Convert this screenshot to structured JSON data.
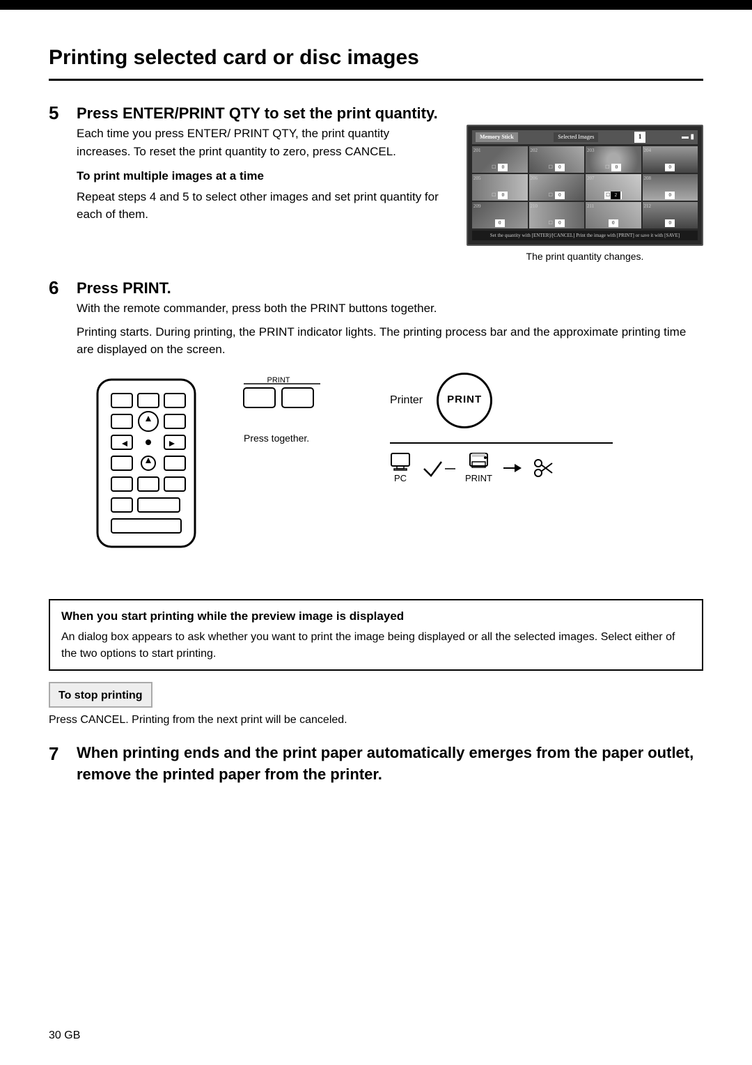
{
  "page": {
    "title": "Printing selected card or disc images",
    "footer": "30 GB"
  },
  "step5": {
    "number": "5",
    "heading": "Press ENTER/PRINT QTY to set the print quantity.",
    "body1": "Each time you press ENTER/ PRINT QTY, the print quantity increases.  To reset the print quantity to zero, press CANCEL.",
    "subheading": "To print multiple images at a time",
    "body2": "Repeat steps 4 and 5 to select other images and set print quantity for each of them.",
    "caption": "The print quantity changes."
  },
  "step6": {
    "number": "6",
    "heading": "Press PRINT.",
    "body1": "With the remote commander, press both the PRINT buttons together.",
    "body2": "Printing starts. During printing, the PRINT indicator lights.  The printing process bar and the approximate printing time are displayed on the screen.",
    "press_together": "Press together.",
    "printer_label": "Printer",
    "print_circle_label": "PRINT",
    "pc_label": "PC",
    "print_label": "PRINT"
  },
  "notice": {
    "title": "When you start printing while the preview image is displayed",
    "body": "An dialog box appears to ask whether you want to print the image being displayed or all the selected images.  Select either of the two options to start printing."
  },
  "stop_printing": {
    "label": "To stop printing",
    "body": "Press CANCEL. Printing from the next print will be canceled."
  },
  "step7": {
    "number": "7",
    "body": "When printing ends and the print paper automatically emerges from the paper outlet, remove the printed paper from the printer."
  },
  "screen": {
    "memory_stick": "Memory Stick",
    "selected_images": "Selected Images",
    "count": "1",
    "bottom_text": "Set the quantity with [ENTER]/[CANCEL] Print the image with [PRINT] or save it with [SAVE]",
    "thumbnails": [
      {
        "num": "201",
        "qty": "0",
        "class": "thumb-img-1"
      },
      {
        "num": "202",
        "qty": "0",
        "class": "thumb-img-2"
      },
      {
        "num": "203",
        "qty": "0",
        "class": "thumb-img-3"
      },
      {
        "num": "204",
        "qty": "0",
        "class": "thumb-img-4"
      },
      {
        "num": "205",
        "qty": "0",
        "class": "thumb-img-5"
      },
      {
        "num": "206",
        "qty": "0",
        "class": "thumb-img-6"
      },
      {
        "num": "207",
        "qty": "2",
        "class": "thumb-img-7"
      },
      {
        "num": "208",
        "qty": "0",
        "class": "thumb-img-8"
      },
      {
        "num": "209",
        "qty": "0",
        "class": "thumb-img-9"
      },
      {
        "num": "210",
        "qty": "0",
        "class": "thumb-img-10"
      },
      {
        "num": "211",
        "qty": "0",
        "class": "thumb-img-11"
      },
      {
        "num": "212",
        "qty": "0",
        "class": "thumb-img-12"
      }
    ]
  }
}
